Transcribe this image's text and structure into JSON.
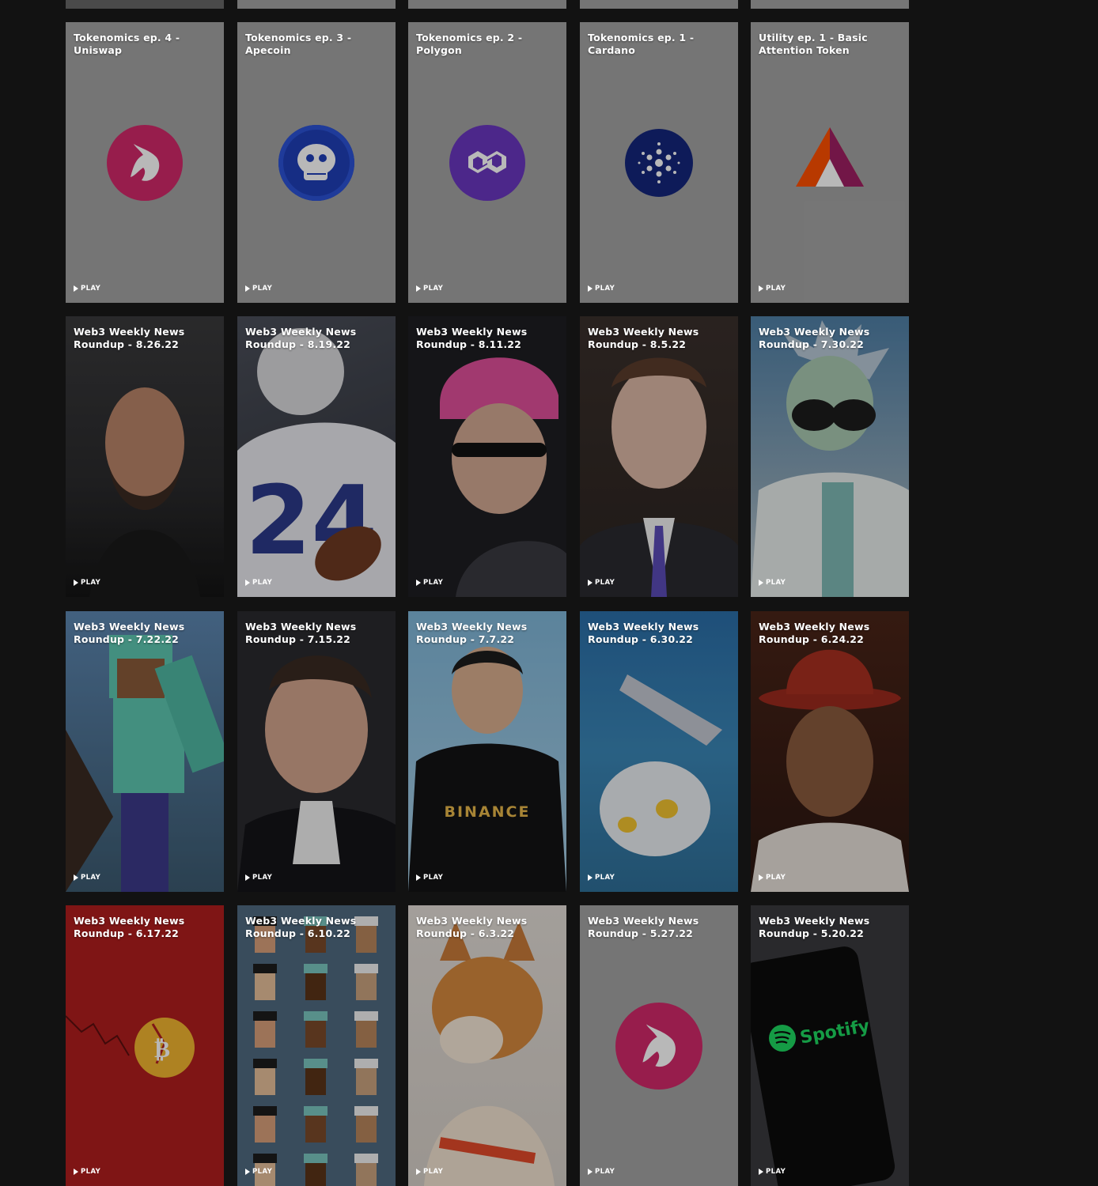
{
  "play_label": "PLAY",
  "colors": {
    "page_bg": "#121212",
    "tile_gray": "#a3a3a3",
    "uniswap": "#d2296a",
    "apecoin": "#1f3fb8",
    "polygon": "#6a36bf",
    "cardano": "#14267c",
    "spotify": "#1ed760"
  },
  "rows": [
    {
      "cards": [
        {
          "title": "Tokenomics ep. 4 - Uniswap",
          "art": "uniswap-logo"
        },
        {
          "title": "Tokenomics ep. 3 - Apecoin",
          "art": "apecoin-logo"
        },
        {
          "title": "Tokenomics ep. 2 - Polygon",
          "art": "polygon-logo"
        },
        {
          "title": "Tokenomics ep. 1 - Cardano",
          "art": "cardano-logo"
        },
        {
          "title": "Utility ep. 1 - Basic Attention Token",
          "art": "bat-logo"
        }
      ]
    },
    {
      "cards": [
        {
          "title": "Web3 Weekly News Roundup - 8.26.22",
          "art": "portrait-photo"
        },
        {
          "title": "Web3 Weekly News Roundup - 8.19.22",
          "art": "football-player-photo"
        },
        {
          "title": "Web3 Weekly News Roundup - 8.11.22",
          "art": "pink-beanie-portrait-photo"
        },
        {
          "title": "Web3 Weekly News Roundup - 8.5.22",
          "art": "suit-portrait-photo"
        },
        {
          "title": "Web3 Weekly News Roundup - 7.30.22",
          "art": "cartoon-scientist-image"
        }
      ]
    },
    {
      "cards": [
        {
          "title": "Web3 Weekly News Roundup - 7.22.22",
          "art": "blocky-game-character-image"
        },
        {
          "title": "Web3 Weekly News Roundup - 7.15.22",
          "art": "tuxedo-portrait-photo"
        },
        {
          "title": "Web3 Weekly News Roundup - 7.7.22",
          "art": "speaker-photo",
          "hoodie_text": "BINANCE"
        },
        {
          "title": "Web3 Weekly News Roundup - 6.30.22",
          "art": "creature-artwork"
        },
        {
          "title": "Web3 Weekly News Roundup - 6.24.22",
          "art": "red-hat-portrait-photo"
        }
      ]
    },
    {
      "cards": [
        {
          "title": "Web3 Weekly News Roundup - 6.17.22",
          "art": "cracked-coin-illustration"
        },
        {
          "title": "Web3 Weekly News Roundup - 6.10.22",
          "art": "pixel-avatars-grid"
        },
        {
          "title": "Web3 Weekly News Roundup - 6.3.22",
          "art": "shiba-dog-photo"
        },
        {
          "title": "Web3 Weekly News Roundup - 5.27.22",
          "art": "uniswap-logo"
        },
        {
          "title": "Web3 Weekly News Roundup - 5.20.22",
          "art": "phone-photo",
          "phone_text": "Spotify"
        }
      ]
    }
  ]
}
